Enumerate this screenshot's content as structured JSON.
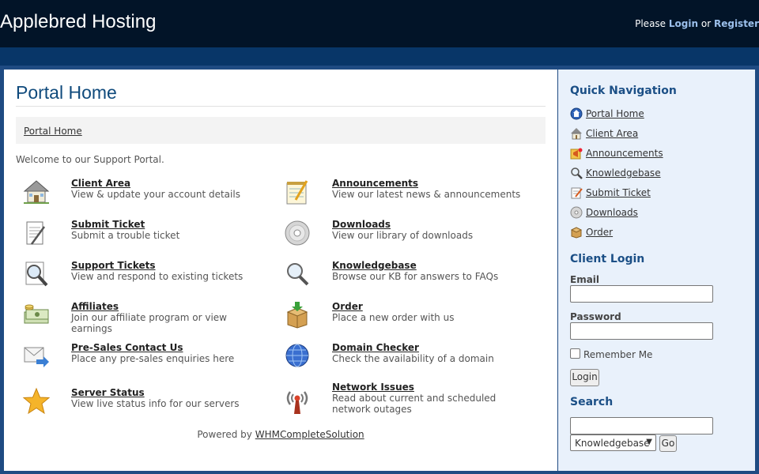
{
  "header": {
    "logo_text": "Applebred Hosting",
    "welcome_prefix": "Please",
    "login_link": "Login",
    "or_text": "or",
    "register_link": "Register",
    "colors": {
      "topbar": "#021428",
      "stripe": "#083668",
      "frame": "#1f4b82",
      "link": "#9cc0ec"
    }
  },
  "main": {
    "title": "Portal Home",
    "breadcrumb": "Portal Home",
    "welcome": "Welcome to our Support Portal.",
    "features": [
      {
        "icon": "house-icon",
        "title": "Client Area",
        "desc": "View & update your account details"
      },
      {
        "icon": "notepad-icon",
        "title": "Announcements",
        "desc": "View our latest news & announcements"
      },
      {
        "icon": "document-pencil-icon",
        "title": "Submit Ticket",
        "desc": "Submit a trouble ticket"
      },
      {
        "icon": "cd-icon",
        "title": "Downloads",
        "desc": "View our library of downloads"
      },
      {
        "icon": "magnifier-document-icon",
        "title": "Support Tickets",
        "desc": "View and respond to existing tickets"
      },
      {
        "icon": "magnifier-icon",
        "title": "Knowledgebase",
        "desc": "Browse our KB for answers to FAQs"
      },
      {
        "icon": "money-icon",
        "title": "Affiliates",
        "desc": "Join our affiliate program or view earnings"
      },
      {
        "icon": "box-icon",
        "title": "Order",
        "desc": "Place a new order with us"
      },
      {
        "icon": "email-arrow-icon",
        "title": "Pre-Sales Contact Us",
        "desc": "Place any pre-sales enquiries here"
      },
      {
        "icon": "globe-icon",
        "title": "Domain Checker",
        "desc": "Check the availability of a domain"
      },
      {
        "icon": "star-icon",
        "title": "Server Status",
        "desc": "View live status info for our servers"
      },
      {
        "icon": "antenna-icon",
        "title": "Network Issues",
        "desc": "Read about current and scheduled network outages"
      }
    ],
    "powered_prefix": "Powered by",
    "powered_link": "WHMCompleteSolution"
  },
  "sidebar": {
    "nav_title": "Quick Navigation",
    "nav_items": [
      {
        "icon": "home-globe-icon",
        "label": "Portal Home"
      },
      {
        "icon": "house-icon",
        "label": "Client Area"
      },
      {
        "icon": "megaphone-icon",
        "label": "Announcements"
      },
      {
        "icon": "magnifier-icon",
        "label": "Knowledgebase"
      },
      {
        "icon": "ticket-pencil-icon",
        "label": "Submit Ticket"
      },
      {
        "icon": "cd-icon",
        "label": "Downloads"
      },
      {
        "icon": "box-icon",
        "label": "Order"
      }
    ],
    "login_title": "Client Login",
    "email_label": "Email",
    "password_label": "Password",
    "remember_label": "Remember Me",
    "login_button": "Login",
    "search_title": "Search",
    "search_select": "Knowledgebase",
    "go_button": "Go"
  }
}
